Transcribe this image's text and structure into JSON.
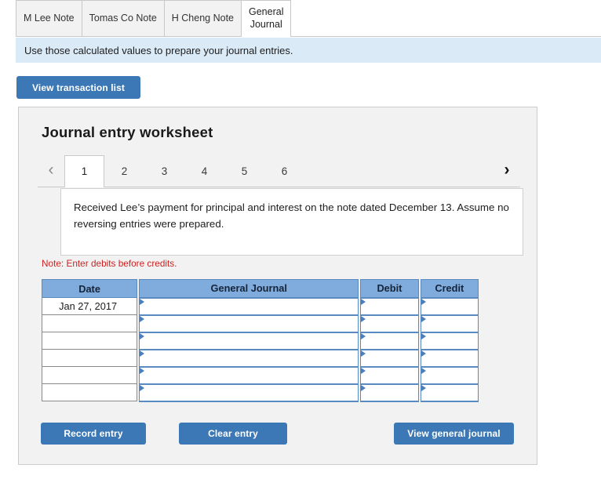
{
  "tabs": [
    {
      "label": "M Lee Note",
      "active": false
    },
    {
      "label": "Tomas Co Note",
      "active": false
    },
    {
      "label": "H Cheng Note",
      "active": false
    },
    {
      "label": "General\nJournal",
      "active": true
    }
  ],
  "banner": {
    "text": "Use those calculated values to prepare your journal entries."
  },
  "toolbar": {
    "view_transaction_list_label": "View transaction list"
  },
  "panel": {
    "title": "Journal entry worksheet",
    "pager": {
      "prev_icon": "‹",
      "next_icon": "›",
      "steps": [
        "1",
        "2",
        "3",
        "4",
        "5",
        "6"
      ],
      "active_step": "1"
    },
    "description": "Received Lee’s payment for principal and interest on the note dated December 13. Assume no reversing entries were prepared.",
    "note": "Note: Enter debits before credits.",
    "table": {
      "headers": [
        "Date",
        "General Journal",
        "Debit",
        "Credit"
      ],
      "rows": [
        {
          "date": "Jan 27, 2017",
          "account": "",
          "debit": "",
          "credit": ""
        },
        {
          "date": "",
          "account": "",
          "debit": "",
          "credit": ""
        },
        {
          "date": "",
          "account": "",
          "debit": "",
          "credit": ""
        },
        {
          "date": "",
          "account": "",
          "debit": "",
          "credit": ""
        },
        {
          "date": "",
          "account": "",
          "debit": "",
          "credit": ""
        },
        {
          "date": "",
          "account": "",
          "debit": "",
          "credit": ""
        }
      ]
    },
    "buttons": {
      "record_entry": "Record entry",
      "clear_entry": "Clear entry",
      "view_general_journal": "View general journal"
    }
  },
  "colors": {
    "accent_blue": "#3c78b5",
    "banner_blue": "#dbeaf7",
    "table_header_blue": "#7fabdd",
    "cell_border_blue": "#5a8bc0",
    "note_red": "#cc2222",
    "panel_gray": "#f2f2f2"
  }
}
